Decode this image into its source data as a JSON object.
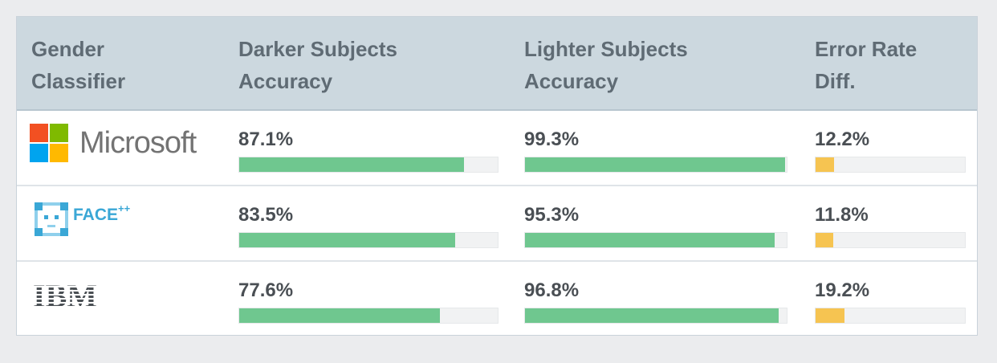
{
  "chart_data": {
    "type": "table",
    "columns": [
      "Gender\nClassifier",
      "Darker Subjects\nAccuracy",
      "Lighter Subjects\nAccuracy",
      "Error Rate\nDiff."
    ],
    "rows": [
      {
        "classifier": "Microsoft",
        "darker": 87.1,
        "darker_label": "87.1%",
        "lighter": 99.3,
        "lighter_label": "99.3%",
        "diff": 12.2,
        "diff_label": "12.2%"
      },
      {
        "classifier": "FACE++",
        "darker": 83.5,
        "darker_label": "83.5%",
        "lighter": 95.3,
        "lighter_label": "95.3%",
        "diff": 11.8,
        "diff_label": "11.8%"
      },
      {
        "classifier": "IBM",
        "darker": 77.6,
        "darker_label": "77.6%",
        "lighter": 96.8,
        "lighter_label": "96.8%",
        "diff": 19.2,
        "diff_label": "19.2%"
      }
    ],
    "accuracy_scale": [
      0,
      100
    ],
    "diff_scale": [
      0,
      100
    ],
    "colors": {
      "accuracy_bar": "#6fc78f",
      "diff_bar": "#f6c451",
      "track": "#f1f2f3",
      "header_bg": "#ccd8df"
    }
  },
  "logos": {
    "microsoft": {
      "text": "Microsoft"
    },
    "facepp": {
      "text": "FACE",
      "sup": "++"
    },
    "ibm": {
      "text": "IBM"
    }
  }
}
